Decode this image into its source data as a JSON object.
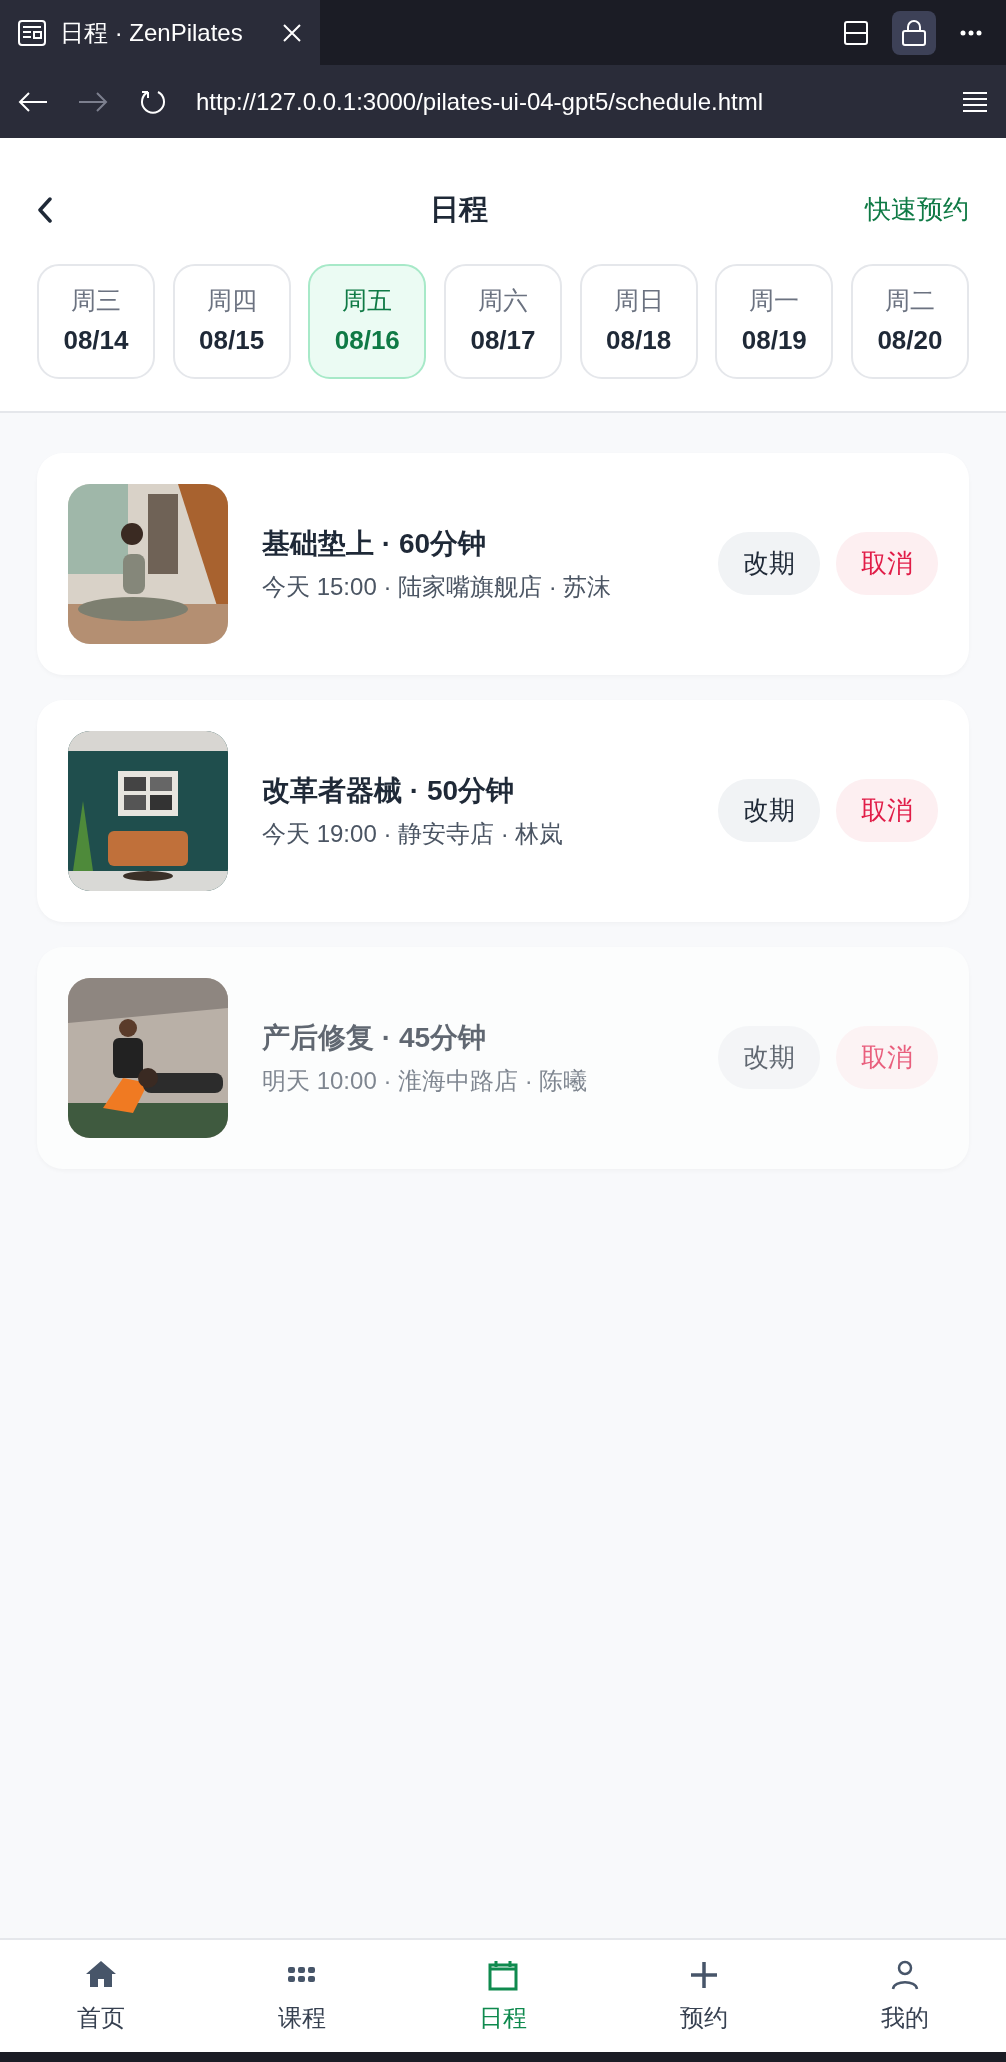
{
  "browser": {
    "tab_title": "日程 · ZenPilates",
    "url": "http://127.0.0.1:3000/pilates-ui-04-gpt5/schedule.html"
  },
  "header": {
    "title": "日程",
    "action": "快速预约"
  },
  "dates": [
    {
      "weekday": "周三",
      "date": "08/14",
      "selected": false
    },
    {
      "weekday": "周四",
      "date": "08/15",
      "selected": false
    },
    {
      "weekday": "周五",
      "date": "08/16",
      "selected": true
    },
    {
      "weekday": "周六",
      "date": "08/17",
      "selected": false
    },
    {
      "weekday": "周日",
      "date": "08/18",
      "selected": false
    },
    {
      "weekday": "周一",
      "date": "08/19",
      "selected": false
    },
    {
      "weekday": "周二",
      "date": "08/20",
      "selected": false
    }
  ],
  "sessions": [
    {
      "title": "基础垫上 · 60分钟",
      "details": "今天 15:00 · 陆家嘴旗舰店 · 苏沫",
      "reschedule": "改期",
      "cancel": "取消",
      "dimmed": false
    },
    {
      "title": "改革者器械 · 50分钟",
      "details": "今天 19:00 · 静安寺店 · 林岚",
      "reschedule": "改期",
      "cancel": "取消",
      "dimmed": false
    },
    {
      "title": "产后修复 · 45分钟",
      "details": "明天 10:00 · 淮海中路店 · 陈曦",
      "reschedule": "改期",
      "cancel": "取消",
      "dimmed": true
    }
  ],
  "tab_bar": [
    {
      "kind": "home",
      "label": "首页",
      "selected": false
    },
    {
      "kind": "grid",
      "label": "课程",
      "selected": false
    },
    {
      "kind": "calendar",
      "label": "日程",
      "selected": true
    },
    {
      "kind": "plus",
      "label": "预约",
      "selected": false
    },
    {
      "kind": "user",
      "label": "我的",
      "selected": false
    }
  ]
}
